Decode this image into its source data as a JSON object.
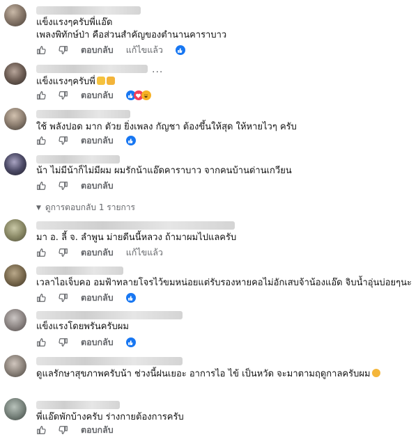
{
  "actions": {
    "reply_label": "ตอบกลับ",
    "edited_label": "แก้ไขแล้ว"
  },
  "colors": {
    "like_blue": "#1877f2",
    "meta_gray": "#65676b"
  },
  "comments": [
    {
      "text_lines": [
        "แข็งแรงๆครับพี่แอ๊ด",
        "เพลงพิทักษ์ป่า คือส่วนสำคัญของตำนานคาราบาว"
      ],
      "edited": true,
      "reactions": [
        "like"
      ]
    },
    {
      "text_lines": [
        "แข็งแรงๆครับพี่"
      ],
      "edited": false,
      "reactions": [
        "like",
        "love",
        "haha"
      ],
      "emoji": [
        "flexed-biceps",
        "love-you-gesture"
      ]
    },
    {
      "text_lines": [
        "ใช้ พลังปอด มาก ตัวย ยิ่งเพลง กัญชา ต้องขึ้นให้สุด ให้หายไวๆ ครับ"
      ],
      "edited": false,
      "reactions": [
        "like"
      ]
    },
    {
      "text_lines": [
        "น้า ไม่มีน้าก็ไม่มีผม ผมรักน้าแอ๊ดคาราบาว จากคนบ้านด่านเกวียน"
      ],
      "edited": false,
      "reactions": []
    },
    {
      "text_lines": [
        "มา อ. ลี้ จ. ลำพูน ม่ายดีนนี้หลวง ถ้ามาผมไปแลครับ"
      ],
      "edited": true,
      "reactions": []
    },
    {
      "text_lines": [
        "เวลาไอเจ็บคอ อมฟ้าทลายโจรไว้ขมหน่อยแต่รับรองหายคอไม่อักเสบจ้าน้องแอ๊ด จิบน้ำอุ่นบ่อยๆนะ"
      ],
      "edited": false,
      "reactions": [
        "like"
      ]
    },
    {
      "text_lines": [
        "แข็งแรงโดยพรันครับผม"
      ],
      "edited": false,
      "reactions": [
        "like"
      ]
    },
    {
      "text_lines": [
        "ดูแลรักษาสุขภาพครับน้า ช่วงนี้ฝนเยอะ อาการไอ ไข้ เป็นหวัด จะมาตามฤดูกาลครับผม"
      ],
      "edited": false,
      "reactions": [],
      "emoji": [
        "smiling-face-with-hearts"
      ]
    },
    {
      "text_lines": [
        "พี่แอ๊ดพักบ้างครับ ร่างกายต้องการครับ"
      ],
      "edited": false,
      "reactions": []
    }
  ],
  "view_replies": "ดูการตอบกลับ 1 รายการ"
}
